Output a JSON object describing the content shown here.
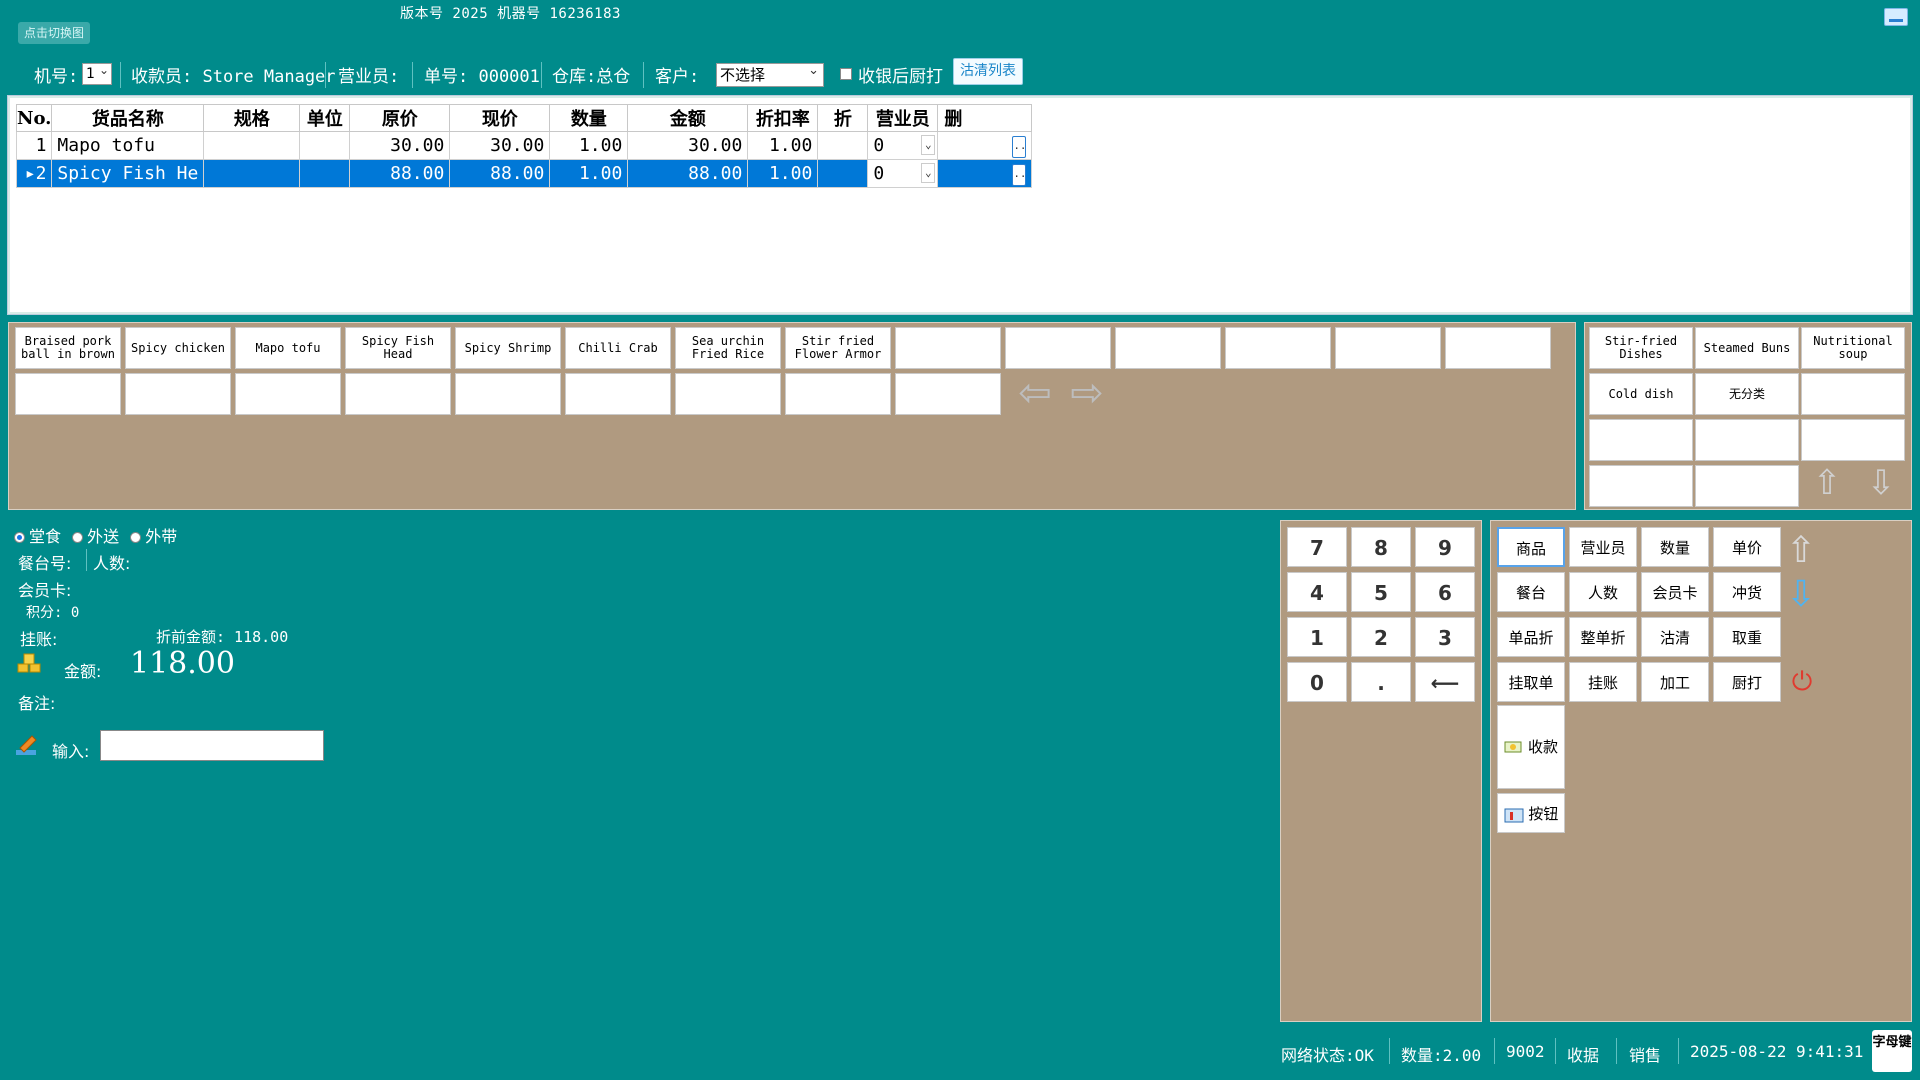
{
  "top": {
    "badge": "点击切换图",
    "version": "版本号 2025 机器号 16236183"
  },
  "info": {
    "machine_label": "机号:",
    "machine_value": "1",
    "cashier": "收款员: Store Manager",
    "salesperson": "营业员:",
    "order_no": "单号: 000001",
    "warehouse": "仓库:总仓",
    "customer_label": "客户:",
    "customer_value": "不选择",
    "kitchen_print_label": "收银后厨打",
    "clear_list_label": "沽清列表"
  },
  "grid": {
    "columns": [
      "No.",
      "货品名称",
      "规格",
      "单位",
      "原价",
      "现价",
      "数量",
      "金额",
      "折扣率",
      "折",
      "营业员",
      "删"
    ],
    "rows": [
      {
        "no": "1",
        "name": "Mapo tofu",
        "spec": "",
        "unit": "",
        "orig": "30.00",
        "price": "30.00",
        "qty": "1.00",
        "amount": "30.00",
        "rate": "1.00",
        "disc": "",
        "staff": "0",
        "del": ".."
      },
      {
        "no": "2",
        "name": "Spicy Fish He",
        "spec": "",
        "unit": "",
        "orig": "88.00",
        "price": "88.00",
        "qty": "1.00",
        "amount": "88.00",
        "rate": "1.00",
        "disc": "",
        "staff": "0",
        "del": ".."
      }
    ]
  },
  "products": [
    "Braised pork ball in brown",
    "Spicy chicken",
    "Mapo tofu",
    "Spicy Fish Head",
    "Spicy Shrimp",
    "Chilli Crab",
    "Sea urchin Fried Rice",
    "Stir fried Flower Armor",
    "",
    "",
    "",
    "",
    "",
    "",
    "",
    "",
    "",
    "",
    "",
    "",
    "",
    "",
    "",
    ""
  ],
  "categories": [
    "Stir-fried Dishes",
    "Steamed Buns",
    "Nutritional soup",
    "Cold dish",
    "无分类",
    "",
    "",
    "",
    "",
    "",
    ""
  ],
  "left": {
    "modes": [
      "堂食",
      "外送",
      "外带"
    ],
    "table_no": "餐台号:",
    "people": "人数:",
    "member_card": "会员卡:",
    "points": "积分: 0",
    "credit": "挂账:",
    "pre_discount": "折前金额: 118.00",
    "amount_label": "金额:",
    "amount_value": "118.00",
    "remark": "备注:",
    "input_label": "输入:"
  },
  "numpad": [
    "7",
    "8",
    "9",
    "4",
    "5",
    "6",
    "1",
    "2",
    "3",
    "0",
    ".",
    "⟵"
  ],
  "functions": [
    "商品",
    "营业员",
    "数量",
    "单价",
    "餐台",
    "人数",
    "会员卡",
    "冲货",
    "单品折",
    "整单折",
    "沽清",
    "取重",
    "挂取单",
    "挂账",
    "加工",
    "厨打"
  ],
  "checkout_label": "收款",
  "buttons_label": "按钮",
  "status": {
    "network": "网络状态:OK",
    "quantity": "数量:2.00",
    "code": "9002",
    "receipt": "收据",
    "mode": "销售",
    "datetime": "2025-08-22 9:41:31",
    "qr": "字母键"
  }
}
